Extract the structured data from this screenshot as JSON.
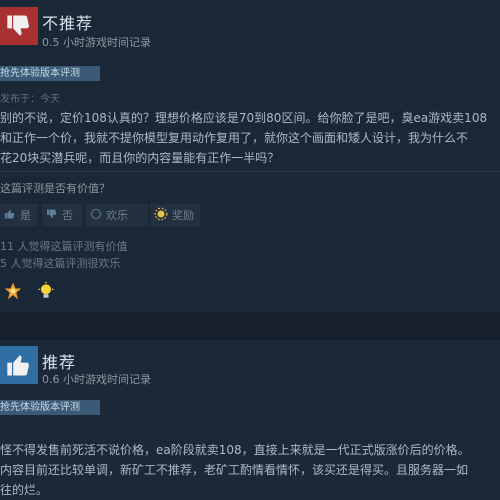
{
  "reviews": [
    {
      "verdict": "不推荐",
      "hours": "0.5 小时游戏时间记录",
      "badge": "抢先体验版本评测",
      "posted": "发布于：今天",
      "lines": [
        "别的不说，定价108认真的？理想价格应该是70到80区间。给你脸了是吧，臭ea游戏卖108",
        "和正作一个价，我就不提你模型复用动作复用了，就你这个画面和矮人设计，我为什么不",
        "花20块买潜兵呢，而且你的内容量能有正作一半吗？"
      ],
      "helpful_question": "这篇评测是否有价值？",
      "buttons": {
        "yes": "是",
        "no": "否",
        "funny": "欢乐",
        "award": "奖励"
      },
      "stats": [
        "11 人觉得这篇评测有价值",
        "5 人觉得这篇评测很欢乐"
      ]
    },
    {
      "verdict": "推荐",
      "hours": "0.6 小时游戏时间记录",
      "badge": "抢先体验版本评测",
      "lines": [
        "怪不得发售前死活不说价格，ea阶段就卖108，直接上来就是一代正式版涨价后的价格。",
        "内容目前还比较单调，新矿工不推荐，老矿工酌情看情怀，该买还是得买。且服务器一如",
        "往的烂。"
      ]
    }
  ],
  "colors": {
    "negative": "#a83232",
    "positive": "#2f6fa3",
    "badge": "#3b5a75"
  },
  "icons": [
    "thumbs-down-icon",
    "thumbs-up-icon",
    "funny-icon",
    "award-icon",
    "medal-icon",
    "lightbulb-icon"
  ]
}
